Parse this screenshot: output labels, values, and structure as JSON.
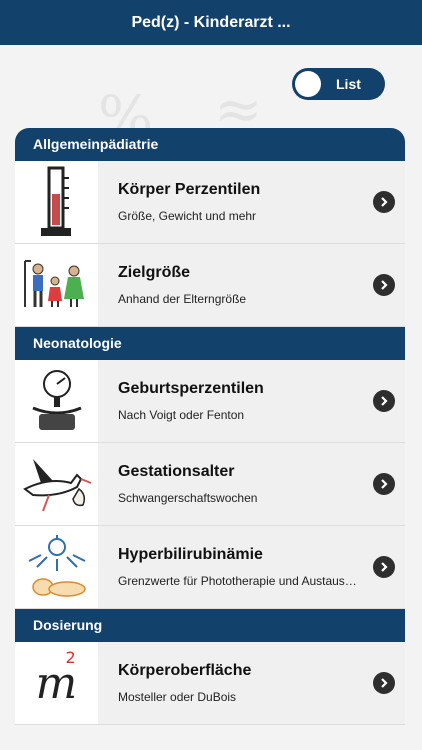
{
  "header": {
    "title": "Ped(z) - Kinderarzt ..."
  },
  "background": {
    "symbol_1": "%",
    "symbol_2": "≈"
  },
  "toggle": {
    "label": "List"
  },
  "sections": [
    {
      "title": "Allgemeinpädiatrie",
      "items": [
        {
          "title": "Körper Perzentilen",
          "subtitle": "Größe, Gewicht und mehr",
          "icon": "height-ruler-icon"
        },
        {
          "title": "Zielgröße",
          "subtitle": "Anhand der Elterngröße",
          "icon": "family-height-icon"
        }
      ]
    },
    {
      "title": "Neonatologie",
      "items": [
        {
          "title": "Geburtsperzentilen",
          "subtitle": "Nach Voigt oder Fenton",
          "icon": "baby-scale-icon"
        },
        {
          "title": "Gestationsalter",
          "subtitle": "Schwangerschaftswochen",
          "icon": "stork-icon"
        },
        {
          "title": "Hyperbilirubinämie",
          "subtitle": "Grenzwerte für Phototherapie und Austaus…",
          "icon": "phototherapy-lamp-icon"
        }
      ]
    },
    {
      "title": "Dosierung",
      "items": [
        {
          "title": "Körperoberfläche",
          "subtitle": "Mosteller oder DuBois",
          "icon": "square-meter-icon",
          "icon_text": "m",
          "icon_superscript": "2"
        }
      ]
    }
  ],
  "colors": {
    "primary": "#12416c",
    "row_bg": "#f0f0f0",
    "chevron": "#2e2e2e"
  }
}
